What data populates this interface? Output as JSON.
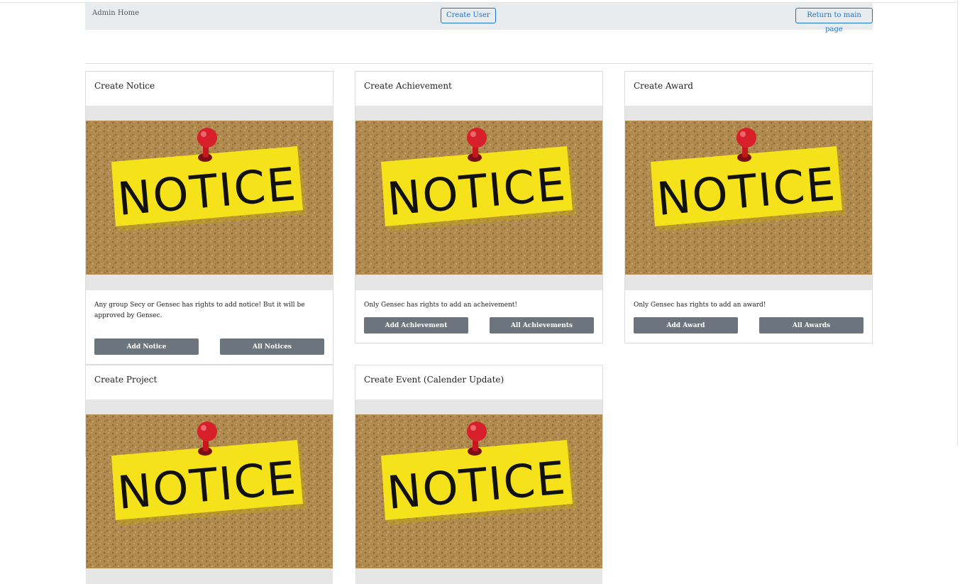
{
  "navbar": {
    "brand": "Admin Home",
    "create_user": "Create User",
    "return_main": "Return to main page"
  },
  "notice_image_text": "NOTICE",
  "cards": [
    {
      "title": "Create Notice",
      "text": "Any group Secy or Gensec has rights to add notice! But it will be approved by Gensec.",
      "btn1": "Add Notice",
      "btn2": "All Notices"
    },
    {
      "title": "Create Achievement",
      "text": "Only Gensec has rights to add an acheivement!",
      "btn1": "Add Achievement",
      "btn2": "All Achievements"
    },
    {
      "title": "Create Award",
      "text": "Only Gensec has rights to add an award!",
      "btn1": "Add Award",
      "btn2": "All Awards"
    },
    {
      "title": "Create Project"
    },
    {
      "title": "Create Event (Calender Update)"
    }
  ],
  "colors": {
    "navbar_bg": "#e9ecef",
    "link_blue": "#1a73c8",
    "button_gray": "#6c757d",
    "cork": "#b08a4e",
    "sticky_yellow": "#f5e21a",
    "pin_red": "#d8202a"
  }
}
